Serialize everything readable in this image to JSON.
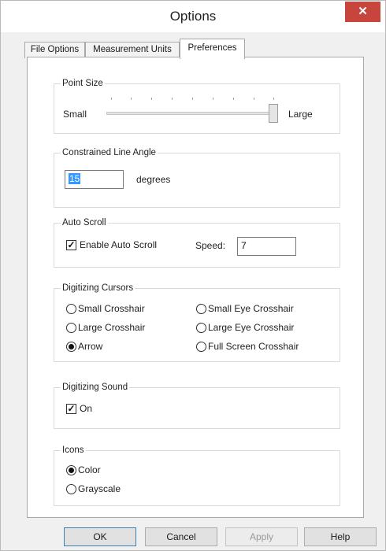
{
  "window": {
    "title": "Options",
    "close_glyph": "✕"
  },
  "tabs": [
    {
      "label": "File Options",
      "active": false
    },
    {
      "label": "Measurement Units",
      "active": false
    },
    {
      "label": "Preferences",
      "active": true
    }
  ],
  "point_size": {
    "legend": "Point Size",
    "min_label": "Small",
    "max_label": "Large",
    "value_fraction": 1.0
  },
  "constrained_line_angle": {
    "legend": "Constrained Line Angle",
    "value": "15",
    "unit": "degrees"
  },
  "auto_scroll": {
    "legend": "Auto Scroll",
    "enable_label": "Enable Auto Scroll",
    "enabled": true,
    "speed_label": "Speed:",
    "speed_value": "7"
  },
  "digitizing_cursors": {
    "legend": "Digitizing Cursors",
    "options": [
      {
        "label": "Small Crosshair",
        "checked": false
      },
      {
        "label": "Small Eye Crosshair",
        "checked": false
      },
      {
        "label": "Large Crosshair",
        "checked": false
      },
      {
        "label": "Large Eye Crosshair",
        "checked": false
      },
      {
        "label": "Arrow",
        "checked": true
      },
      {
        "label": "Full Screen Crosshair",
        "checked": false
      }
    ]
  },
  "digitizing_sound": {
    "legend": "Digitizing Sound",
    "on_label": "On",
    "on": true
  },
  "icons": {
    "legend": "Icons",
    "options": [
      {
        "label": "Color",
        "checked": true
      },
      {
        "label": "Grayscale",
        "checked": false
      }
    ]
  },
  "buttons": {
    "ok": "OK",
    "cancel": "Cancel",
    "apply": "Apply",
    "help": "Help"
  },
  "glyphs": {
    "check": "✓"
  }
}
